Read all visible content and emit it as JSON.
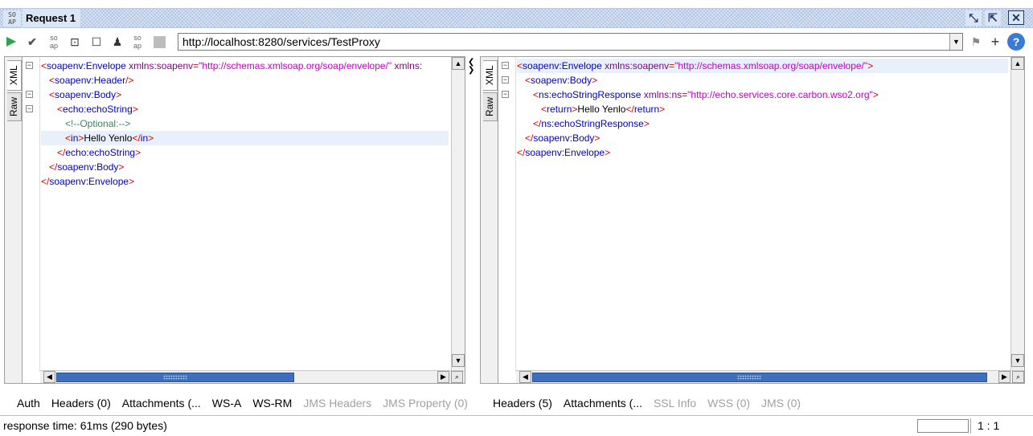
{
  "window": {
    "title": "Request 1",
    "icon_text": "SO AP"
  },
  "toolbar": {
    "url": "http://localhost:8280/services/TestProxy",
    "icons": [
      "run-icon",
      "validate-icon",
      "wsdl-icon",
      "view-icon",
      "stop-icon",
      "user-icon",
      "soap-icon",
      "disabled-icon"
    ]
  },
  "request": {
    "side_tabs": [
      "XML",
      "Raw"
    ],
    "bottom_tabs": [
      {
        "label": "Auth",
        "enabled": true
      },
      {
        "label": "Headers (0)",
        "enabled": true
      },
      {
        "label": "Attachments (...",
        "enabled": true
      },
      {
        "label": "WS-A",
        "enabled": true
      },
      {
        "label": "WS-RM",
        "enabled": true
      },
      {
        "label": "JMS Headers",
        "enabled": false
      },
      {
        "label": "JMS Property (0)",
        "enabled": false
      }
    ],
    "lines": [
      "<soapenv:Envelope xmlns:soapenv=\"http://schemas.xmlsoap.org/soap/envelope/\" xmlns:",
      "   <soapenv:Header/>",
      "   <soapenv:Body>",
      "      <echo:echoString>",
      "         <!--Optional:-->",
      "         <in>Hello Yenlo</in>",
      "      </echo:echoString>",
      "   </soapenv:Body>",
      "</soapenv:Envelope>"
    ]
  },
  "response": {
    "side_tabs": [
      "XML",
      "Raw"
    ],
    "bottom_tabs": [
      {
        "label": "Headers (5)",
        "enabled": true
      },
      {
        "label": "Attachments (...",
        "enabled": true
      },
      {
        "label": "SSL Info",
        "enabled": false
      },
      {
        "label": "WSS (0)",
        "enabled": false
      },
      {
        "label": "JMS (0)",
        "enabled": false
      }
    ],
    "lines": [
      "<soapenv:Envelope xmlns:soapenv=\"http://schemas.xmlsoap.org/soap/envelope/\">",
      "   <soapenv:Body>",
      "      <ns:echoStringResponse xmlns:ns=\"http://echo.services.core.carbon.wso2.org\">",
      "         <return>Hello Yenlo</return>",
      "      </ns:echoStringResponse>",
      "   </soapenv:Body>",
      "</soapenv:Envelope>"
    ]
  },
  "status": {
    "response_time": "response time: 61ms (290 bytes)",
    "caret_position": "1 : 1"
  }
}
